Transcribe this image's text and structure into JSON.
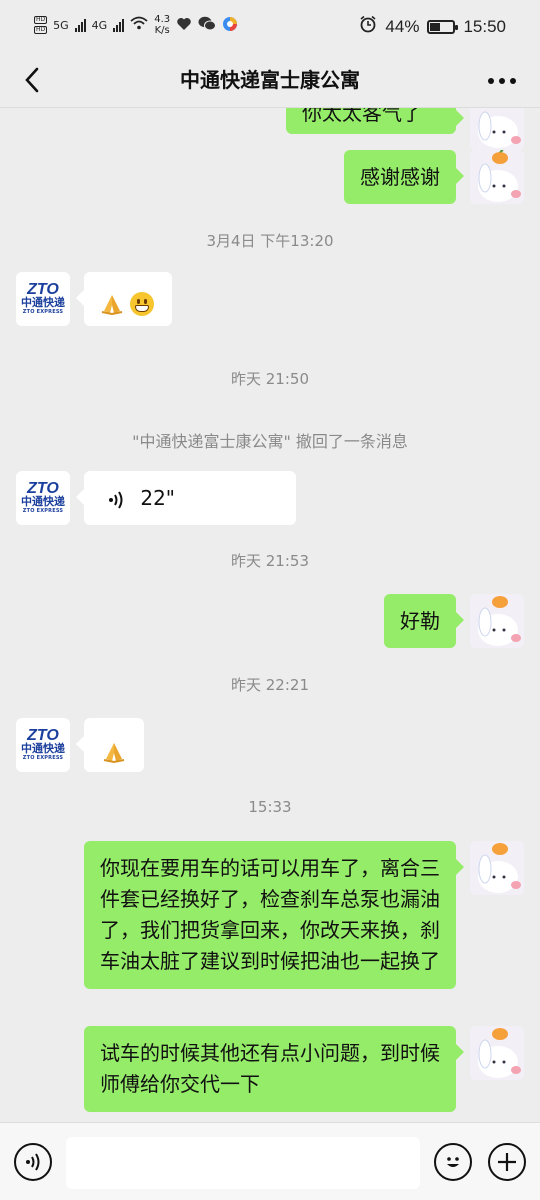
{
  "status": {
    "left_speed_value": "4.3",
    "left_speed_unit": "K/s",
    "net1": "5G",
    "net2": "4G",
    "battery": "44%",
    "battery_level": 0.44,
    "time": "15:50"
  },
  "header": {
    "title": "中通快递富士康公寓"
  },
  "messages": {
    "m0": {
      "text": "你太太客气了"
    },
    "m1": {
      "text": "感谢感谢"
    },
    "t1": "3月4日 下午13:20",
    "t2": "昨天 21:50",
    "recall": "\"中通快递富士康公寓\" 撤回了一条消息",
    "voice_duration": "22\"",
    "t3": "昨天 21:53",
    "m4": {
      "text": "好勒"
    },
    "t4": "昨天 22:21",
    "t5": "15:33",
    "m6": {
      "text": "你现在要用车的话可以用车了，离合三件套已经换好了，检查刹车总泵也漏油了，我们把货拿回来，你改天来换，刹车油太脏了建议到时候把油也一起换了"
    },
    "m7": {
      "text": "试车的时候其他还有点小问题，到时候师傅给你交代一下"
    }
  },
  "avatar_them": {
    "logo": "ZTO",
    "name_cn": "中通快递",
    "name_en": "ZTO EXPRESS"
  },
  "colors": {
    "me_bubble": "#95ec69",
    "them_bubble": "#ffffff",
    "background": "#ededed"
  }
}
